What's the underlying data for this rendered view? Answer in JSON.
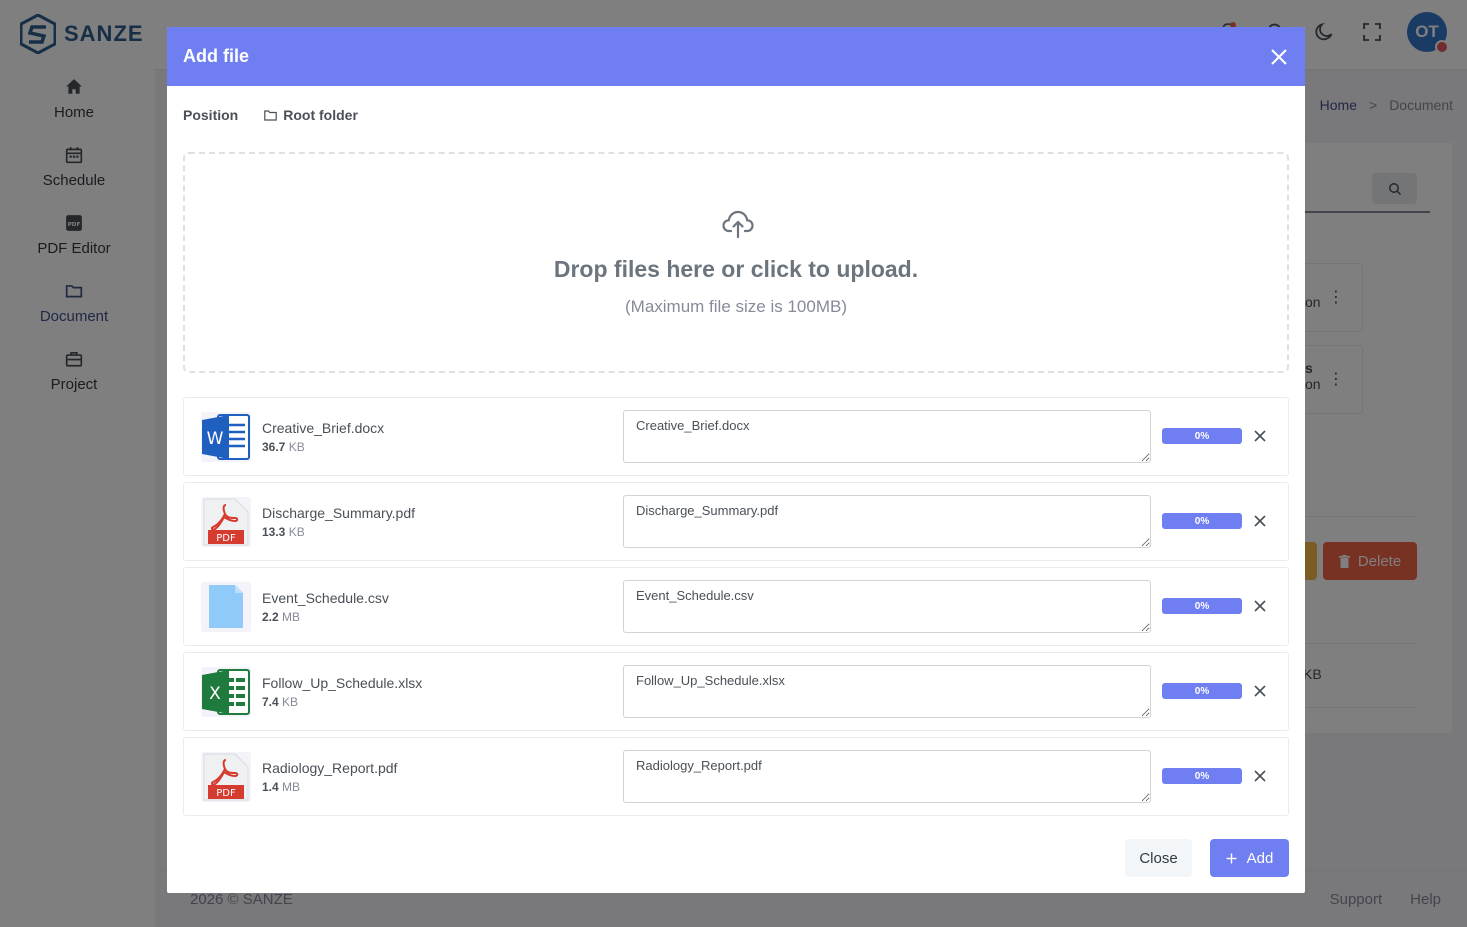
{
  "app": {
    "brand": "SANZE",
    "nav": [
      {
        "label": "Home",
        "icon": "home-icon"
      },
      {
        "label": "Schedule",
        "icon": "calendar-icon"
      },
      {
        "label": "PDF Editor",
        "icon": "pdf-icon"
      },
      {
        "label": "Document",
        "icon": "folder-icon",
        "active": true
      },
      {
        "label": "Project",
        "icon": "briefcase-icon"
      }
    ],
    "user_initials": "OT",
    "breadcrumb": {
      "home": "Home",
      "separator": ">",
      "current": "Document"
    },
    "bg": {
      "tile1_text": "on",
      "tile2_line1": "s",
      "tile2_line2": "on",
      "delete_label": "Delete",
      "size_fragment": "KB"
    },
    "footer": {
      "copyright": "2026 © SANZE",
      "support": "Support",
      "help": "Help"
    }
  },
  "modal": {
    "title": "Add file",
    "position_label": "Position",
    "folder_label": "Root folder",
    "dropzone": {
      "message": "Drop files here or click to upload.",
      "hint": "(Maximum file size is 100MB)"
    },
    "files": [
      {
        "name": "Creative_Brief.docx",
        "size_num": "36.7",
        "size_unit": "KB",
        "type": "word-icon",
        "value": "Creative_Brief.docx",
        "progress": "0%"
      },
      {
        "name": "Discharge_Summary.pdf",
        "size_num": "13.3",
        "size_unit": "KB",
        "type": "pdf-file-icon",
        "value": "Discharge_Summary.pdf",
        "progress": "0%"
      },
      {
        "name": "Event_Schedule.csv",
        "size_num": "2.2",
        "size_unit": "MB",
        "type": "generic-file-icon",
        "value": "Event_Schedule.csv",
        "progress": "0%"
      },
      {
        "name": "Follow_Up_Schedule.xlsx",
        "size_num": "7.4",
        "size_unit": "KB",
        "type": "excel-icon",
        "value": "Follow_Up_Schedule.xlsx",
        "progress": "0%"
      },
      {
        "name": "Radiology_Report.pdf",
        "size_num": "1.4",
        "size_unit": "MB",
        "type": "pdf-file-icon",
        "value": "Radiology_Report.pdf",
        "progress": "0%"
      }
    ],
    "pdf_badge": "PDF",
    "close_label": "Close",
    "add_label": "Add"
  },
  "colors": {
    "accent": "#6f7ff2",
    "danger": "#f06548",
    "warning": "#f7b84b",
    "brand": "#2f5f8d"
  }
}
